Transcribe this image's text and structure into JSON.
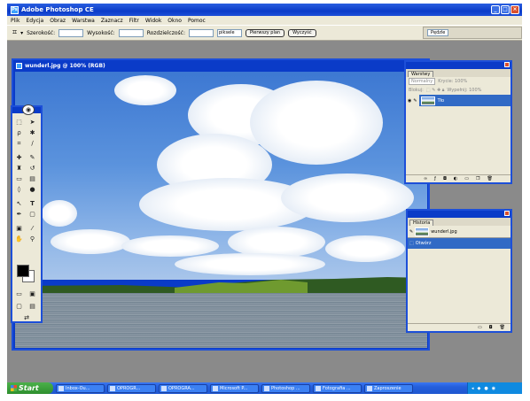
{
  "app": {
    "title": "Adobe Photoshop CE"
  },
  "menu": [
    "Plik",
    "Edycja",
    "Obraz",
    "Warstwa",
    "Zaznacz",
    "Filtr",
    "Widok",
    "Okno",
    "Pomoc"
  ],
  "options": {
    "szerokosc_label": "Szerokość:",
    "wysokosc_label": "Wysokość:",
    "rozdzielczosc_label": "Rozdzielczość:",
    "unit": "piksele",
    "front_image_button": "Pierwszy plan",
    "clear_button": "Wyczyść",
    "palette_well": "Pędzle"
  },
  "document": {
    "title": "wunderl.jpg @ 100% (RGB)"
  },
  "layers_panel": {
    "tab": "Warstwy",
    "normal_label": "Normalny",
    "opacity_label": "Krycie: 100%",
    "lock_label": "Blokuj:",
    "fill_label": "Wypełnij: 100%",
    "layer_name": "Tło"
  },
  "history_panel": {
    "tab": "Historia",
    "snapshot": "wunderl.jpg",
    "state": "Otwórz"
  },
  "taskbar": {
    "start": "Start",
    "items": [
      "Inbox-Ou...",
      "OPROGR...",
      "OPROGRA...",
      "Microsoft P...",
      "Photoshop ...",
      "Fotografia ...",
      "Zaproszenie"
    ]
  },
  "colors": {
    "title_blue": "#0a3bc8",
    "xp_gray": "#ece9d8",
    "start_green": "#3c9e3c"
  }
}
